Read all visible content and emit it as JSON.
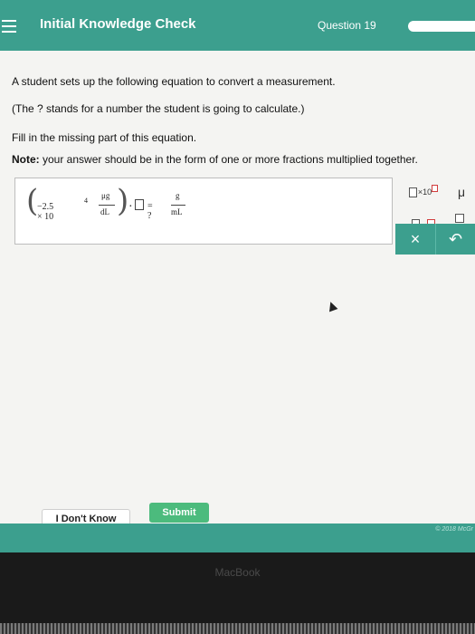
{
  "header": {
    "title": "Initial Knowledge Check",
    "question_label": "Question 19"
  },
  "prompt": {
    "line1": "A student sets up the following equation to convert a measurement.",
    "line2": "(The ? stands for a number the student is going to calculate.)",
    "line3": "Fill in the missing part of this equation.",
    "note_label": "Note:",
    "note_text": " your answer should be in the form of one or more fractions multiplied together."
  },
  "equation": {
    "coefficient": "−2.5 × 10",
    "exponent": "4",
    "unit_numerator": "μg",
    "unit_denominator": "dL",
    "dot": "·",
    "equals_unknown": "= ?",
    "result_numerator": "g",
    "result_denominator": "mL"
  },
  "tools": {
    "sci_notation": "×10",
    "mu": "μ",
    "multiply_dot": "·",
    "clear": "×",
    "undo": "↶"
  },
  "buttons": {
    "dont_know": "I Don't Know",
    "submit": "Submit"
  },
  "footer": {
    "copyright": "© 2018 McGr"
  },
  "bezel": {
    "brand": "MacBook"
  },
  "colors": {
    "header": "#3c9f8e",
    "submit": "#4cbb7d"
  }
}
